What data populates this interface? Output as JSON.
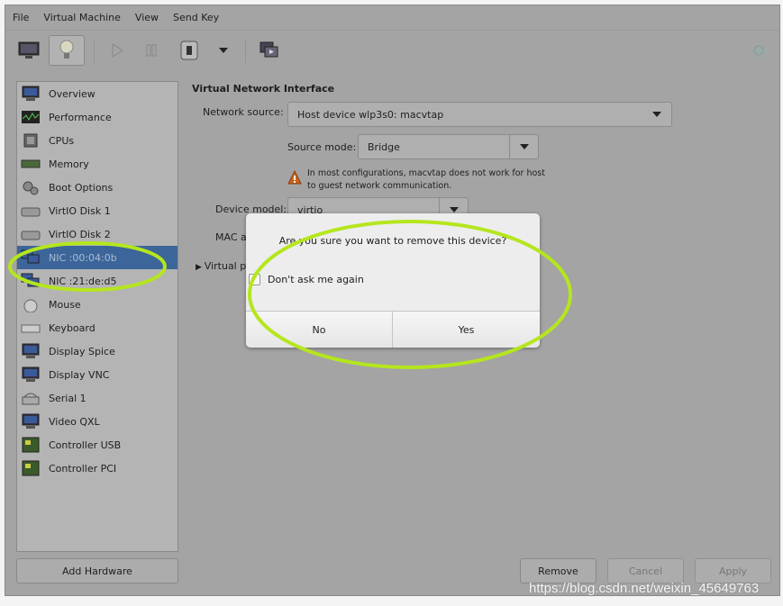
{
  "menubar": [
    "File",
    "Virtual Machine",
    "View",
    "Send Key"
  ],
  "toolbar": {
    "icons": [
      "monitor-icon",
      "lightbulb-icon",
      "play-icon",
      "pause-icon",
      "power-icon",
      "dropdown-icon",
      "fullscreen-icon"
    ]
  },
  "sidebar": {
    "items": [
      {
        "label": "Overview",
        "icon": "monitor-icon"
      },
      {
        "label": "Performance",
        "icon": "chart-icon"
      },
      {
        "label": "CPUs",
        "icon": "cpu-icon"
      },
      {
        "label": "Memory",
        "icon": "memory-icon"
      },
      {
        "label": "Boot Options",
        "icon": "gear-icon"
      },
      {
        "label": "VirtIO Disk 1",
        "icon": "disk-icon"
      },
      {
        "label": "VirtIO Disk 2",
        "icon": "disk-icon"
      },
      {
        "label": "NIC :00:04:0b",
        "icon": "network-icon",
        "selected": true
      },
      {
        "label": "NIC :21:de:d5",
        "icon": "network-icon"
      },
      {
        "label": "Mouse",
        "icon": "mouse-icon"
      },
      {
        "label": "Keyboard",
        "icon": "keyboard-icon"
      },
      {
        "label": "Display Spice",
        "icon": "monitor-icon"
      },
      {
        "label": "Display VNC",
        "icon": "monitor-icon"
      },
      {
        "label": "Serial 1",
        "icon": "serial-icon"
      },
      {
        "label": "Video QXL",
        "icon": "monitor-icon"
      },
      {
        "label": "Controller USB",
        "icon": "controller-icon"
      },
      {
        "label": "Controller PCI",
        "icon": "controller-icon"
      }
    ],
    "add_hardware": "Add Hardware"
  },
  "main": {
    "section_title": "Virtual Network Interface",
    "network_source_label": "Network source:",
    "network_source_value": "Host device wlp3s0: macvtap",
    "source_mode_label": "Source mode:",
    "source_mode_value": "Bridge",
    "warning_line1": "In most configurations, macvtap does not work for host",
    "warning_line2": "to guest network communication.",
    "device_model_label": "Device model:",
    "device_model_value": "virtio",
    "mac_label": "MAC a",
    "virtual_port_label": "Virtual p"
  },
  "buttons": {
    "remove": "Remove",
    "cancel": "Cancel",
    "apply": "Apply"
  },
  "dialog": {
    "message": "Are you sure you want to remove this device?",
    "checkbox_label": "Don't ask me again",
    "checkbox_checked": false,
    "no": "No",
    "yes": "Yes"
  },
  "annotation_color": "#b5e61d",
  "selection_color": "#3c669a",
  "watermark": "https://blog.csdn.net/weixin_45649763"
}
